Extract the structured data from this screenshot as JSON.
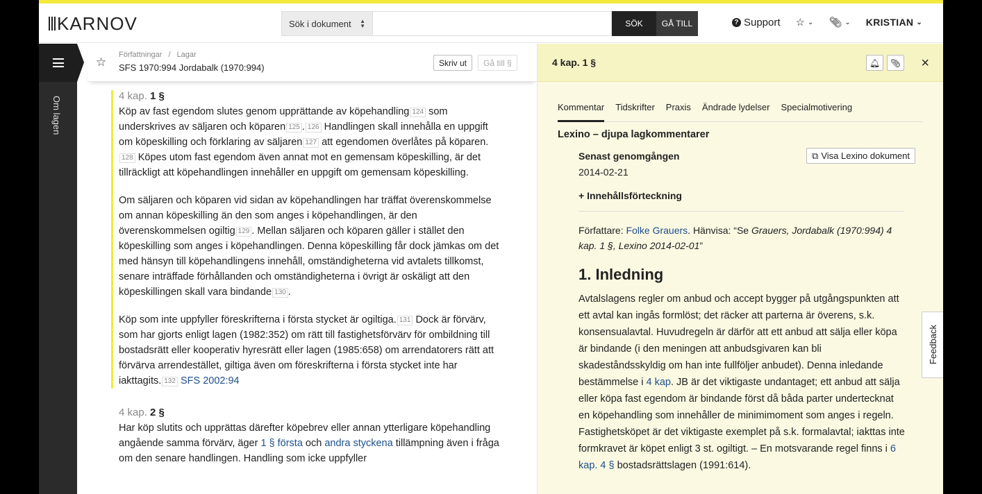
{
  "header": {
    "logo_text": "KARNOV",
    "search_scope": "Sök i dokument",
    "search_placeholder": "",
    "search_button": "SÖK",
    "goto_button": "GÅ TILL",
    "support_label": "Support",
    "user_name": "KRISTIAN"
  },
  "rail": {
    "label": "Om lagen"
  },
  "document": {
    "breadcrumb": [
      "Författningar",
      "Lagar"
    ],
    "title": "SFS 1970:994 Jordabalk (1970:994)",
    "print_button": "Skriv ut",
    "goto_button": "Gå till §",
    "sections": [
      {
        "kap": "4 kap.",
        "par": "1 §",
        "paragraphs": [
          [
            {
              "t": "Köp av fast egendom slutes genom upprättande av köpehandling"
            },
            {
              "fn": "124"
            },
            {
              "t": " som underskrives av säljaren och köparen"
            },
            {
              "fn": "125"
            },
            {
              "t": "."
            },
            {
              "fn": "126"
            },
            {
              "t": " Handlingen skall innehålla en uppgift om köpeskilling och förklaring av säljaren"
            },
            {
              "fn": "127"
            },
            {
              "t": " att egendomen överlåtes på köparen."
            },
            {
              "fn": "128"
            },
            {
              "t": " Köpes utom fast egendom även annat mot en gemensam köpeskilling, är det tillräckligt att köpehandlingen innehåller en uppgift om gemensam köpeskilling."
            }
          ],
          [
            {
              "t": "Om säljaren och köparen vid sidan av köpehandlingen har träffat överenskommelse om annan köpeskilling än den som anges i köpehandlingen, är den överenskommelsen ogiltig"
            },
            {
              "fn": "129"
            },
            {
              "t": ". Mellan säljaren och köparen gäller i stället den köpeskilling som anges i köpehandlingen. Denna köpeskilling får dock jämkas om det med hänsyn till köpehandlingens innehåll, omständigheterna vid avtalets tillkomst, senare inträffade förhållanden och omständigheterna i övrigt är oskäligt att den köpeskillingen skall vara bindande"
            },
            {
              "fn": "130"
            },
            {
              "t": "."
            }
          ],
          [
            {
              "t": "Köp som inte uppfyller föreskrifterna i första stycket är ogiltiga."
            },
            {
              "fn": "131"
            },
            {
              "t": " Dock är förvärv, som har gjorts enligt lagen (1982:352) om rätt till fastighetsförvärv för ombildning till bostadsrätt eller kooperativ hyresrätt eller lagen (1985:658) om arrendatorers rätt att förvärva arrendestället, giltiga även om föreskrifterna i första stycket inte har iakttagits."
            },
            {
              "fn": "132"
            },
            {
              "t": " "
            },
            {
              "link": "SFS 2002:94"
            }
          ]
        ]
      },
      {
        "kap": "4 kap.",
        "par": "2 §",
        "paragraphs": [
          [
            {
              "t": "Har köp slutits och upprättas därefter köpebrev eller annan ytterligare köpehandling angående samma förvärv, äger "
            },
            {
              "link": "1 § första"
            },
            {
              "t": " och "
            },
            {
              "link": "andra styckena"
            },
            {
              "t": " tillämpning även i fråga om den senare handlingen. Handling som icke uppfyller"
            }
          ]
        ]
      }
    ]
  },
  "commentary": {
    "title": "4 kap. 1 §",
    "tabs": [
      "Kommentar",
      "Tidskrifter",
      "Praxis",
      "Ändrade lydelser",
      "Specialmotivering"
    ],
    "active_tab": "Kommentar",
    "heading": "Lexino – djupa lagkommentarer",
    "reviewed_label": "Senast genomgången",
    "reviewed_date": "2014-02-21",
    "view_button": "Visa Lexino dokument",
    "toc_label": "+ Innehållsförteckning",
    "author_prefix": "Författare: ",
    "author_name": "Folke Grauers",
    "cite_prefix": ". Hänvisa: “Se ",
    "cite_text": "Grauers, Jordabalk (1970:994) 4 kap. 1 §, Lexino 2014-02-01",
    "cite_suffix": "”",
    "section_heading": "1. Inledning",
    "body": [
      {
        "t": "Avtalslagens regler om anbud och accept bygger på utgångspunkten att ett avtal kan ingås formlöst; det räcker att parterna är överens, s.k. konsensualavtal. Huvudregeln är därför att ett anbud att sälja eller köpa är bindande (i den meningen att anbudsgivaren kan bli skadeståndsskyldig om han inte fullföljer anbudet). Denna inledande bestämmelse i "
      },
      {
        "link": "4 kap"
      },
      {
        "t": ". JB är det viktigaste undantaget; ett anbud att sälja eller köpa fast egendom är bindande först då båda parter undertecknat en köpehandling som innehåller de minimimoment som anges i regeln. Fastighetsköpet är det viktigaste exemplet på s.k. formalavtal; iakttas inte formkravet är köpet enligt 3 st. ogiltigt. – En motsvarande regel finns i "
      },
      {
        "link": "6 kap. 4 §"
      },
      {
        "t": " bostadsrättslagen (1991:614)."
      }
    ]
  },
  "feedback_label": "Feedback"
}
